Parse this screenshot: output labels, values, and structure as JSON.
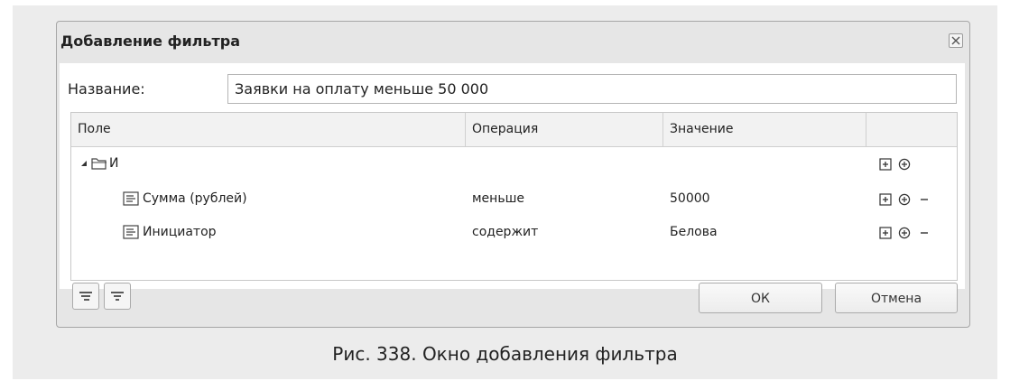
{
  "dialog": {
    "title": "Добавление фильтра",
    "name_label": "Название:",
    "name_value": "Заявки на оплату меньше 50 000"
  },
  "grid": {
    "columns": [
      "Поле",
      "Операция",
      "Значение",
      ""
    ],
    "group": {
      "label": "И",
      "expanded": true
    },
    "rows": [
      {
        "field": "Сумма (рублей)",
        "operation": "меньше",
        "value": "50000"
      },
      {
        "field": "Инициатор",
        "operation": "содержит",
        "value": "Белова"
      }
    ]
  },
  "buttons": {
    "ok": "ОК",
    "cancel": "Отмена"
  },
  "icons": {
    "close": "close-icon",
    "folder": "folder-icon",
    "field": "field-icon",
    "add_condition": "add-condition-icon",
    "add_group": "add-group-icon",
    "remove": "remove-icon",
    "filter_a": "filter-icon",
    "filter_b": "filter-icon"
  },
  "caption": "Рис. 338. Окно добавления фильтра"
}
